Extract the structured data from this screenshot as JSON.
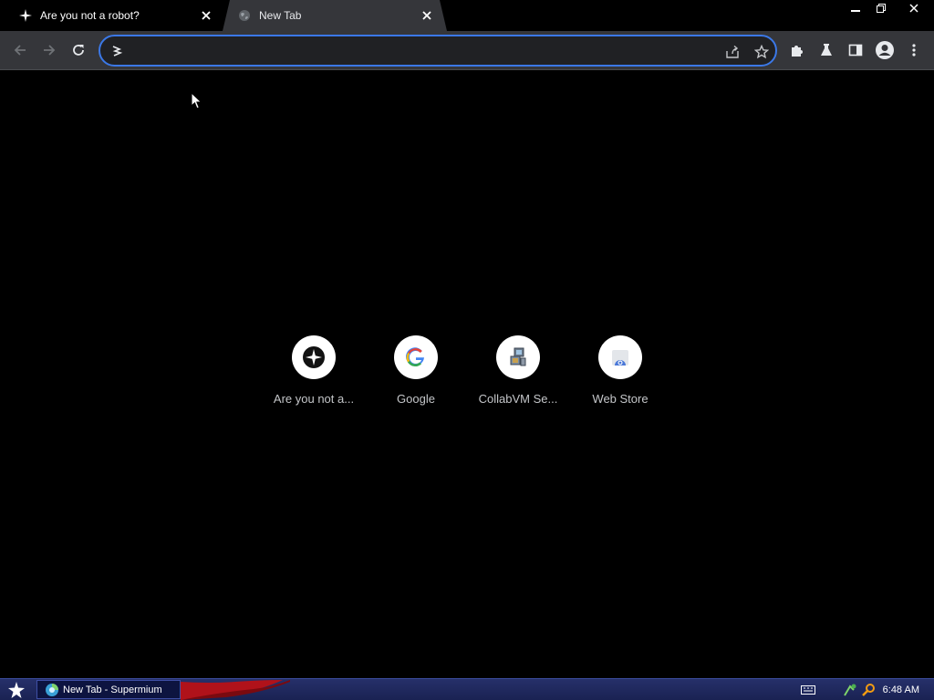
{
  "tabs": [
    {
      "title": "Are you not a robot?",
      "favicon": "sparkle-icon",
      "active": false
    },
    {
      "title": "New Tab",
      "favicon": "globe-icon",
      "active": true
    }
  ],
  "window_controls": {
    "minimize": "minimize-icon",
    "restore": "restore-icon",
    "close": "close-icon"
  },
  "toolbar": {
    "back": "back-arrow-icon",
    "forward": "forward-arrow-icon",
    "reload": "reload-icon",
    "omnibox": {
      "value": "",
      "placeholder": ""
    },
    "extensions": "puzzle-icon",
    "labs": "flask-icon",
    "side_panel": "side-panel-icon",
    "profile": "avatar-icon",
    "menu": "kebab-menu-icon"
  },
  "shortcuts": [
    {
      "label": "Are you not a...",
      "icon": "compass-star-icon"
    },
    {
      "label": "Google",
      "icon": "google-g-icon"
    },
    {
      "label": "CollabVM Se...",
      "icon": "computer-icon"
    },
    {
      "label": "Web Store",
      "icon": "web-store-icon"
    }
  ],
  "taskbar": {
    "start": "start-star-icon",
    "active_window": "New Tab - Supermium",
    "clock": "6:48 AM"
  },
  "colors": {
    "background": "#000000",
    "toolbar": "#35363a",
    "omnibox_focus": "#3b78e7",
    "taskbar": "#1f2760"
  }
}
